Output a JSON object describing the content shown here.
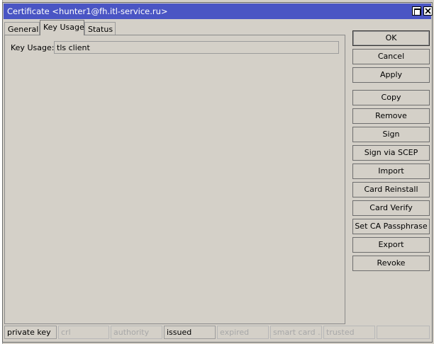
{
  "window": {
    "title": "Certificate <hunter1@fh.itl-service.ru>"
  },
  "tabs": [
    {
      "label": "General"
    },
    {
      "label": "Key Usage"
    },
    {
      "label": "Status"
    }
  ],
  "key_usage": {
    "label": "Key Usage:",
    "value": "tls client"
  },
  "buttons": {
    "ok": "OK",
    "cancel": "Cancel",
    "apply": "Apply",
    "copy": "Copy",
    "remove": "Remove",
    "sign": "Sign",
    "sign_via_scep": "Sign via SCEP",
    "import": "Import",
    "card_reinstall": "Card Reinstall",
    "card_verify": "Card Verify",
    "set_ca_passphrase": "Set CA Passphrase",
    "export": "Export",
    "revoke": "Revoke"
  },
  "status_bar": [
    {
      "label": "private key",
      "active": true
    },
    {
      "label": "crl",
      "active": false
    },
    {
      "label": "authority",
      "active": false
    },
    {
      "label": "issued",
      "active": true
    },
    {
      "label": "expired",
      "active": false
    },
    {
      "label": "smart card ...",
      "active": false
    },
    {
      "label": "trusted",
      "active": false
    },
    {
      "label": "",
      "active": false
    }
  ]
}
